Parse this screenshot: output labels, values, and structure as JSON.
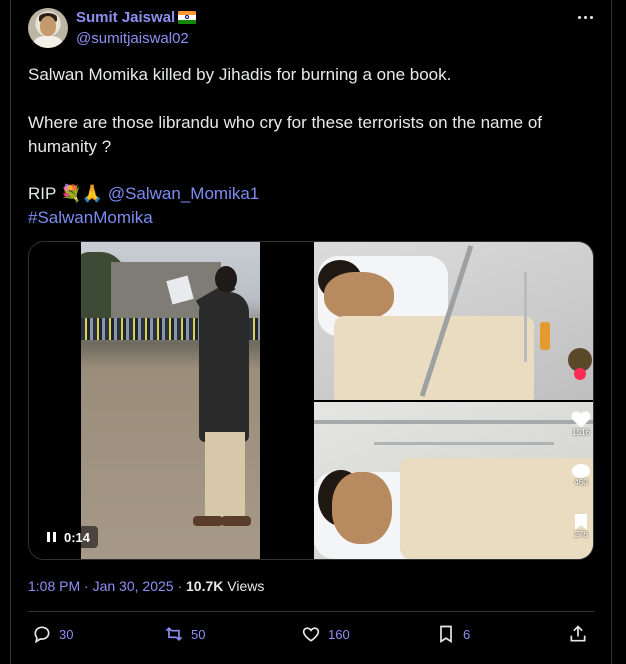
{
  "author": {
    "name": "Sumit Jaiswal",
    "handle": "@sumitjaiswal02",
    "flag_icon": "india-flag-icon"
  },
  "tweet": {
    "line1": "Salwan Momika killed by Jihadis for burning a one book.",
    "line2": "Where are those librandu who cry for these terrorists on the name of",
    "line3": "humanity ?",
    "rip_prefix": "RIP 💐🙏",
    "mention": "@Salwan_Momika1",
    "hashtag": "#SalwanMomika"
  },
  "media": {
    "video_time": "0:14",
    "overlay_counts": [
      "1516",
      "460",
      "276"
    ]
  },
  "meta": {
    "time": "1:08 PM",
    "sep": "·",
    "date": "Jan 30, 2025",
    "views_count": "10.7K",
    "views_label": "Views"
  },
  "actions": {
    "replies": "30",
    "reposts": "50",
    "likes": "160",
    "bookmarks": "6"
  },
  "colors": {
    "background": "#000000",
    "accent": "#8f8ff2",
    "text": "#e7e9ea",
    "border": "#2f3336"
  }
}
